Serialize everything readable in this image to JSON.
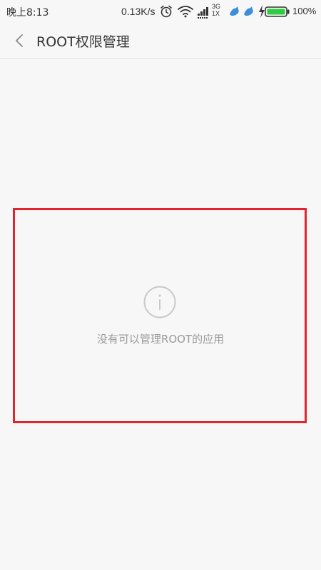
{
  "status_bar": {
    "time": "晚上8:13",
    "net_speed": "0.13K/s",
    "battery_percent": "100%",
    "icons": [
      "alarm-icon",
      "wifi-icon",
      "signal-3g-1x-icon",
      "bird-notification-icon",
      "charging-icon",
      "battery-icon"
    ],
    "network_label_top": "3G",
    "network_label_bottom": "1X"
  },
  "header": {
    "title": "ROOT权限管理",
    "back_icon": "chevron-left-icon"
  },
  "empty_state": {
    "icon": "info-icon",
    "message": "没有可以管理ROOT的应用"
  },
  "colors": {
    "background": "#f7f7f7",
    "highlight_border": "#e0252c",
    "battery_green": "#2ecc40",
    "muted_text": "#9a9a9a"
  }
}
